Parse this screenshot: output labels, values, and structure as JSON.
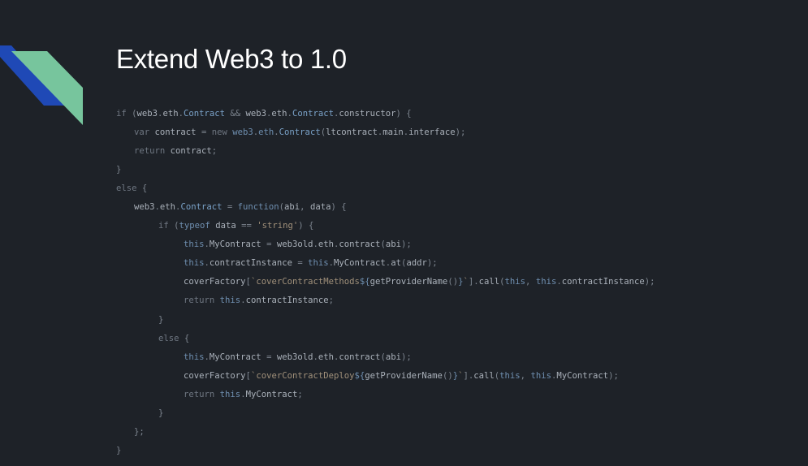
{
  "slide": {
    "title": "Extend Web3 to 1.0",
    "colors": {
      "background": "#1e2228",
      "title": "#ffffff",
      "stripe_blue": "#1f49b6",
      "stripe_green": "#77c59d",
      "code_default": "#9aa2ac",
      "code_keyword": "#6f7782",
      "code_function": "#6f8fb0",
      "code_class": "#7aa2c8",
      "code_string": "#a0907a"
    }
  },
  "code": {
    "lines": [
      {
        "indent": 0,
        "tokens": [
          {
            "t": "if",
            "k": "kw"
          },
          {
            "t": " (",
            "k": "pn"
          },
          {
            "t": "web3",
            "k": "id"
          },
          {
            "t": ".",
            "k": "pn"
          },
          {
            "t": "eth",
            "k": "id"
          },
          {
            "t": ".",
            "k": "pn"
          },
          {
            "t": "Contract",
            "k": "cls"
          },
          {
            "t": " && ",
            "k": "pn"
          },
          {
            "t": "web3",
            "k": "id"
          },
          {
            "t": ".",
            "k": "pn"
          },
          {
            "t": "eth",
            "k": "id"
          },
          {
            "t": ".",
            "k": "pn"
          },
          {
            "t": "Contract",
            "k": "cls"
          },
          {
            "t": ".",
            "k": "pn"
          },
          {
            "t": "constructor",
            "k": "id"
          },
          {
            "t": ") {",
            "k": "pn"
          }
        ]
      },
      {
        "indent": 1,
        "tokens": [
          {
            "t": "var",
            "k": "kw"
          },
          {
            "t": " ",
            "k": "pn"
          },
          {
            "t": "contract",
            "k": "id"
          },
          {
            "t": " = ",
            "k": "pn"
          },
          {
            "t": "new",
            "k": "kw"
          },
          {
            "t": " ",
            "k": "pn"
          },
          {
            "t": "web3",
            "k": "fn"
          },
          {
            "t": ".",
            "k": "pn"
          },
          {
            "t": "eth",
            "k": "fn"
          },
          {
            "t": ".",
            "k": "pn"
          },
          {
            "t": "Contract",
            "k": "cls"
          },
          {
            "t": "(",
            "k": "pn"
          },
          {
            "t": "ltcontract",
            "k": "id"
          },
          {
            "t": ".",
            "k": "pn"
          },
          {
            "t": "main",
            "k": "id"
          },
          {
            "t": ".",
            "k": "pn"
          },
          {
            "t": "interface",
            "k": "id"
          },
          {
            "t": ");",
            "k": "pn"
          }
        ]
      },
      {
        "indent": 1,
        "tokens": [
          {
            "t": "return",
            "k": "kw"
          },
          {
            "t": " ",
            "k": "pn"
          },
          {
            "t": "contract",
            "k": "id"
          },
          {
            "t": ";",
            "k": "pn"
          }
        ]
      },
      {
        "indent": 0,
        "tokens": [
          {
            "t": "}",
            "k": "pn"
          }
        ]
      },
      {
        "indent": 0,
        "tokens": [
          {
            "t": "else",
            "k": "kw"
          },
          {
            "t": " {",
            "k": "pn"
          }
        ]
      },
      {
        "indent": 1,
        "tokens": [
          {
            "t": "web3",
            "k": "id"
          },
          {
            "t": ".",
            "k": "pn"
          },
          {
            "t": "eth",
            "k": "id"
          },
          {
            "t": ".",
            "k": "pn"
          },
          {
            "t": "Contract",
            "k": "cls"
          },
          {
            "t": " = ",
            "k": "pn"
          },
          {
            "t": "function",
            "k": "fn"
          },
          {
            "t": "(",
            "k": "pn"
          },
          {
            "t": "abi",
            "k": "id"
          },
          {
            "t": ", ",
            "k": "pn"
          },
          {
            "t": "data",
            "k": "id"
          },
          {
            "t": ") {",
            "k": "pn"
          }
        ]
      },
      {
        "indent": 2,
        "tokens": [
          {
            "t": "if",
            "k": "kw"
          },
          {
            "t": " (",
            "k": "pn"
          },
          {
            "t": "typeof",
            "k": "fn"
          },
          {
            "t": " ",
            "k": "pn"
          },
          {
            "t": "data",
            "k": "id"
          },
          {
            "t": " == ",
            "k": "pn"
          },
          {
            "t": "'string'",
            "k": "str"
          },
          {
            "t": ") {",
            "k": "pn"
          }
        ]
      },
      {
        "indent": 3,
        "tokens": [
          {
            "t": "this",
            "k": "fn"
          },
          {
            "t": ".",
            "k": "pn"
          },
          {
            "t": "MyContract",
            "k": "id"
          },
          {
            "t": " = ",
            "k": "pn"
          },
          {
            "t": "web3old",
            "k": "id"
          },
          {
            "t": ".",
            "k": "pn"
          },
          {
            "t": "eth",
            "k": "id"
          },
          {
            "t": ".",
            "k": "pn"
          },
          {
            "t": "contract",
            "k": "id"
          },
          {
            "t": "(",
            "k": "pn"
          },
          {
            "t": "abi",
            "k": "id"
          },
          {
            "t": ");",
            "k": "pn"
          }
        ]
      },
      {
        "indent": 3,
        "tokens": [
          {
            "t": "this",
            "k": "fn"
          },
          {
            "t": ".",
            "k": "pn"
          },
          {
            "t": "contractInstance",
            "k": "id"
          },
          {
            "t": " = ",
            "k": "pn"
          },
          {
            "t": "this",
            "k": "fn"
          },
          {
            "t": ".",
            "k": "pn"
          },
          {
            "t": "MyContract",
            "k": "id"
          },
          {
            "t": ".",
            "k": "pn"
          },
          {
            "t": "at",
            "k": "id"
          },
          {
            "t": "(",
            "k": "pn"
          },
          {
            "t": "addr",
            "k": "id"
          },
          {
            "t": ");",
            "k": "pn"
          }
        ]
      },
      {
        "indent": 3,
        "tokens": [
          {
            "t": "coverFactory",
            "k": "id"
          },
          {
            "t": "[",
            "k": "pn"
          },
          {
            "t": "`coverContractMethods",
            "k": "str"
          },
          {
            "t": "${",
            "k": "fn"
          },
          {
            "t": "getProviderName",
            "k": "id"
          },
          {
            "t": "()",
            "k": "pn"
          },
          {
            "t": "}",
            "k": "fn"
          },
          {
            "t": "`",
            "k": "str"
          },
          {
            "t": "].",
            "k": "pn"
          },
          {
            "t": "call",
            "k": "id"
          },
          {
            "t": "(",
            "k": "pn"
          },
          {
            "t": "this",
            "k": "fn"
          },
          {
            "t": ", ",
            "k": "pn"
          },
          {
            "t": "this",
            "k": "fn"
          },
          {
            "t": ".",
            "k": "pn"
          },
          {
            "t": "contractInstance",
            "k": "id"
          },
          {
            "t": ");",
            "k": "pn"
          }
        ]
      },
      {
        "indent": 3,
        "tokens": [
          {
            "t": "return",
            "k": "kw"
          },
          {
            "t": " ",
            "k": "pn"
          },
          {
            "t": "this",
            "k": "fn"
          },
          {
            "t": ".",
            "k": "pn"
          },
          {
            "t": "contractInstance",
            "k": "id"
          },
          {
            "t": ";",
            "k": "pn"
          }
        ]
      },
      {
        "indent": 2,
        "tokens": [
          {
            "t": "}",
            "k": "pn"
          }
        ]
      },
      {
        "indent": 2,
        "tokens": [
          {
            "t": "else",
            "k": "kw"
          },
          {
            "t": " {",
            "k": "pn"
          }
        ]
      },
      {
        "indent": 3,
        "tokens": [
          {
            "t": "this",
            "k": "fn"
          },
          {
            "t": ".",
            "k": "pn"
          },
          {
            "t": "MyContract",
            "k": "id"
          },
          {
            "t": " = ",
            "k": "pn"
          },
          {
            "t": "web3old",
            "k": "id"
          },
          {
            "t": ".",
            "k": "pn"
          },
          {
            "t": "eth",
            "k": "id"
          },
          {
            "t": ".",
            "k": "pn"
          },
          {
            "t": "contract",
            "k": "id"
          },
          {
            "t": "(",
            "k": "pn"
          },
          {
            "t": "abi",
            "k": "id"
          },
          {
            "t": ");",
            "k": "pn"
          }
        ]
      },
      {
        "indent": 3,
        "tokens": [
          {
            "t": "coverFactory",
            "k": "id"
          },
          {
            "t": "[",
            "k": "pn"
          },
          {
            "t": "`coverContractDeploy",
            "k": "str"
          },
          {
            "t": "${",
            "k": "fn"
          },
          {
            "t": "getProviderName",
            "k": "id"
          },
          {
            "t": "()",
            "k": "pn"
          },
          {
            "t": "}",
            "k": "fn"
          },
          {
            "t": "`",
            "k": "str"
          },
          {
            "t": "].",
            "k": "pn"
          },
          {
            "t": "call",
            "k": "id"
          },
          {
            "t": "(",
            "k": "pn"
          },
          {
            "t": "this",
            "k": "fn"
          },
          {
            "t": ", ",
            "k": "pn"
          },
          {
            "t": "this",
            "k": "fn"
          },
          {
            "t": ".",
            "k": "pn"
          },
          {
            "t": "MyContract",
            "k": "id"
          },
          {
            "t": ");",
            "k": "pn"
          }
        ]
      },
      {
        "indent": 3,
        "tokens": [
          {
            "t": "return",
            "k": "kw"
          },
          {
            "t": " ",
            "k": "pn"
          },
          {
            "t": "this",
            "k": "fn"
          },
          {
            "t": ".",
            "k": "pn"
          },
          {
            "t": "MyContract",
            "k": "id"
          },
          {
            "t": ";",
            "k": "pn"
          }
        ]
      },
      {
        "indent": 2,
        "tokens": [
          {
            "t": "}",
            "k": "pn"
          }
        ]
      },
      {
        "indent": 1,
        "tokens": [
          {
            "t": "};",
            "k": "pn"
          }
        ]
      },
      {
        "indent": 0,
        "tokens": [
          {
            "t": "}",
            "k": "pn"
          }
        ]
      }
    ]
  }
}
